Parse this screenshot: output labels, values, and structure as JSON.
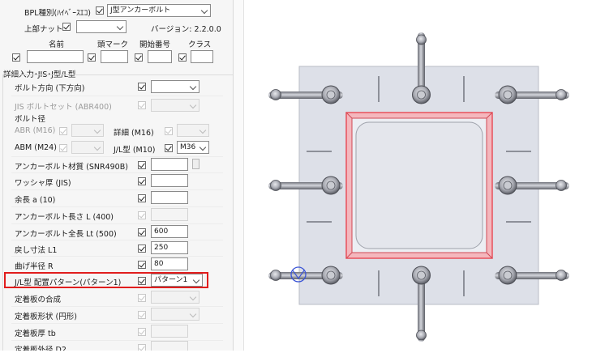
{
  "header": {
    "bpl_type_label": "BPL種別(ﾊｲﾍﾞｰｽｴｺ)",
    "bpl_type_value": "J型アンカーボルト",
    "top_nut_label": "上部ナット",
    "version_label": "バージョン: 2.2.0.0"
  },
  "name_row": {
    "name": "名前",
    "head_mark": "頭マーク",
    "start_no": "開始番号",
    "class": "クラス"
  },
  "group_title": "詳細入力･JIS･J型/L型",
  "rows": {
    "bolt_dir": {
      "label": "ボルト方向 (下方向)"
    },
    "jis_set": {
      "label": "JIS ボルトセット (ABR400)"
    },
    "bolt_dia": {
      "label": "ボルト径"
    },
    "abr": {
      "label": "ABR (M16)"
    },
    "detail": {
      "label": "詳細 (M16)"
    },
    "abm": {
      "label": "ABM (M24)"
    },
    "jl_dia": {
      "label": "J/L型 (M10)",
      "value": "M36"
    },
    "material": {
      "label": "アンカーボルト材質 (SNR490B)"
    },
    "washer": {
      "label": "ワッシャ厚 (JIS)"
    },
    "extra_len": {
      "label": "余長 a (10)"
    },
    "anchor_len": {
      "label": "アンカーボルト長さ L (400)"
    },
    "total_len": {
      "label": "アンカーボルト全長 Lt (500)",
      "value": "600"
    },
    "return_len": {
      "label": "戻し寸法 L1",
      "value": "250"
    },
    "bend_r": {
      "label": "曲げ半径 R",
      "value": "80"
    },
    "pattern": {
      "label": "J/L型 配置パターン(パターン1)",
      "value": "パターン1"
    },
    "plate_comp": {
      "label": "定着板の合成"
    },
    "plate_shape": {
      "label": "定着板形状 (円形)"
    },
    "plate_tb": {
      "label": "定着板厚 tb"
    },
    "plate_d2": {
      "label": "定着板外径 D2"
    }
  },
  "colors": {
    "highlight": "#e11d1d",
    "column_outline": "#e8505b",
    "plate_fill": "#dde0e8"
  }
}
